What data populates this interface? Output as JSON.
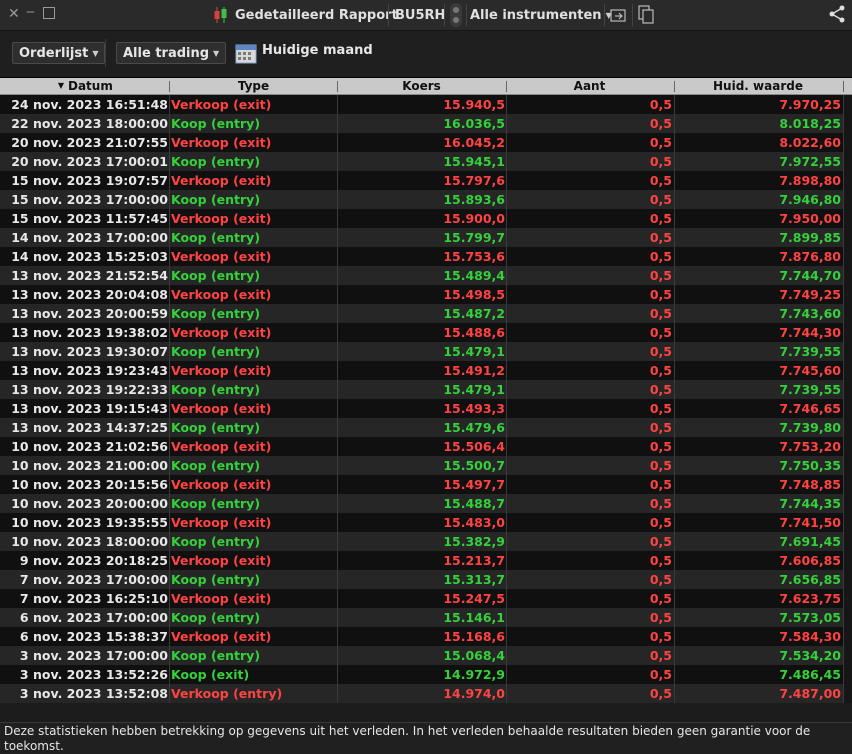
{
  "titlebar": {
    "report_title": "Gedetailleerd Rapport",
    "account_code": "BU5RH",
    "instruments_label": "Alle instrumenten"
  },
  "toolbar": {
    "orderlist_label": "Orderlijst",
    "trading_label": "Alle trading",
    "period_label": "Huidige maand"
  },
  "table": {
    "columns": [
      "Datum",
      "Type",
      "Koers",
      "Aant",
      "Huid. waarde"
    ],
    "sort_column": "Datum",
    "rows": [
      {
        "date": "24 nov. 2023 16:51:48",
        "type": "Verkoop (exit)",
        "side": "sell",
        "koers": "15.940,5",
        "aant": "0,5",
        "waarde": "7.970,25"
      },
      {
        "date": "22 nov. 2023 18:00:00",
        "type": "Koop (entry)",
        "side": "buy",
        "koers": "16.036,5",
        "aant": "0,5",
        "waarde": "8.018,25"
      },
      {
        "date": "20 nov. 2023 21:07:55",
        "type": "Verkoop (exit)",
        "side": "sell",
        "koers": "16.045,2",
        "aant": "0,5",
        "waarde": "8.022,60"
      },
      {
        "date": "20 nov. 2023 17:00:01",
        "type": "Koop (entry)",
        "side": "buy",
        "koers": "15.945,1",
        "aant": "0,5",
        "waarde": "7.972,55"
      },
      {
        "date": "15 nov. 2023 19:07:57",
        "type": "Verkoop (exit)",
        "side": "sell",
        "koers": "15.797,6",
        "aant": "0,5",
        "waarde": "7.898,80"
      },
      {
        "date": "15 nov. 2023 17:00:00",
        "type": "Koop (entry)",
        "side": "buy",
        "koers": "15.893,6",
        "aant": "0,5",
        "waarde": "7.946,80"
      },
      {
        "date": "15 nov. 2023 11:57:45",
        "type": "Verkoop (exit)",
        "side": "sell",
        "koers": "15.900,0",
        "aant": "0,5",
        "waarde": "7.950,00"
      },
      {
        "date": "14 nov. 2023 17:00:00",
        "type": "Koop (entry)",
        "side": "buy",
        "koers": "15.799,7",
        "aant": "0,5",
        "waarde": "7.899,85"
      },
      {
        "date": "14 nov. 2023 15:25:03",
        "type": "Verkoop (exit)",
        "side": "sell",
        "koers": "15.753,6",
        "aant": "0,5",
        "waarde": "7.876,80"
      },
      {
        "date": "13 nov. 2023 21:52:54",
        "type": "Koop (entry)",
        "side": "buy",
        "koers": "15.489,4",
        "aant": "0,5",
        "waarde": "7.744,70"
      },
      {
        "date": "13 nov. 2023 20:04:08",
        "type": "Verkoop (exit)",
        "side": "sell",
        "koers": "15.498,5",
        "aant": "0,5",
        "waarde": "7.749,25"
      },
      {
        "date": "13 nov. 2023 20:00:59",
        "type": "Koop (entry)",
        "side": "buy",
        "koers": "15.487,2",
        "aant": "0,5",
        "waarde": "7.743,60"
      },
      {
        "date": "13 nov. 2023 19:38:02",
        "type": "Verkoop (exit)",
        "side": "sell",
        "koers": "15.488,6",
        "aant": "0,5",
        "waarde": "7.744,30"
      },
      {
        "date": "13 nov. 2023 19:30:07",
        "type": "Koop (entry)",
        "side": "buy",
        "koers": "15.479,1",
        "aant": "0,5",
        "waarde": "7.739,55"
      },
      {
        "date": "13 nov. 2023 19:23:43",
        "type": "Verkoop (exit)",
        "side": "sell",
        "koers": "15.491,2",
        "aant": "0,5",
        "waarde": "7.745,60"
      },
      {
        "date": "13 nov. 2023 19:22:33",
        "type": "Koop (entry)",
        "side": "buy",
        "koers": "15.479,1",
        "aant": "0,5",
        "waarde": "7.739,55"
      },
      {
        "date": "13 nov. 2023 19:15:43",
        "type": "Verkoop (exit)",
        "side": "sell",
        "koers": "15.493,3",
        "aant": "0,5",
        "waarde": "7.746,65"
      },
      {
        "date": "13 nov. 2023 14:37:25",
        "type": "Koop (entry)",
        "side": "buy",
        "koers": "15.479,6",
        "aant": "0,5",
        "waarde": "7.739,80"
      },
      {
        "date": "10 nov. 2023 21:02:56",
        "type": "Verkoop (exit)",
        "side": "sell",
        "koers": "15.506,4",
        "aant": "0,5",
        "waarde": "7.753,20"
      },
      {
        "date": "10 nov. 2023 21:00:00",
        "type": "Koop (entry)",
        "side": "buy",
        "koers": "15.500,7",
        "aant": "0,5",
        "waarde": "7.750,35"
      },
      {
        "date": "10 nov. 2023 20:15:56",
        "type": "Verkoop (exit)",
        "side": "sell",
        "koers": "15.497,7",
        "aant": "0,5",
        "waarde": "7.748,85"
      },
      {
        "date": "10 nov. 2023 20:00:00",
        "type": "Koop (entry)",
        "side": "buy",
        "koers": "15.488,7",
        "aant": "0,5",
        "waarde": "7.744,35"
      },
      {
        "date": "10 nov. 2023 19:35:55",
        "type": "Verkoop (exit)",
        "side": "sell",
        "koers": "15.483,0",
        "aant": "0,5",
        "waarde": "7.741,50"
      },
      {
        "date": "10 nov. 2023 18:00:00",
        "type": "Koop (entry)",
        "side": "buy",
        "koers": "15.382,9",
        "aant": "0,5",
        "waarde": "7.691,45"
      },
      {
        "date": "9 nov. 2023 20:18:25",
        "type": "Verkoop (exit)",
        "side": "sell",
        "koers": "15.213,7",
        "aant": "0,5",
        "waarde": "7.606,85"
      },
      {
        "date": "7 nov. 2023 17:00:00",
        "type": "Koop (entry)",
        "side": "buy",
        "koers": "15.313,7",
        "aant": "0,5",
        "waarde": "7.656,85"
      },
      {
        "date": "7 nov. 2023 16:25:10",
        "type": "Verkoop (exit)",
        "side": "sell",
        "koers": "15.247,5",
        "aant": "0,5",
        "waarde": "7.623,75"
      },
      {
        "date": "6 nov. 2023 17:00:00",
        "type": "Koop (entry)",
        "side": "buy",
        "koers": "15.146,1",
        "aant": "0,5",
        "waarde": "7.573,05"
      },
      {
        "date": "6 nov. 2023 15:38:37",
        "type": "Verkoop (exit)",
        "side": "sell",
        "koers": "15.168,6",
        "aant": "0,5",
        "waarde": "7.584,30"
      },
      {
        "date": "3 nov. 2023 17:00:00",
        "type": "Koop (entry)",
        "side": "buy",
        "koers": "15.068,4",
        "aant": "0,5",
        "waarde": "7.534,20"
      },
      {
        "date": "3 nov. 2023 13:52:26",
        "type": "Koop (exit)",
        "side": "buy",
        "koers": "14.972,9",
        "aant": "0,5",
        "waarde": "7.486,45"
      },
      {
        "date": "3 nov. 2023 13:52:08",
        "type": "Verkoop (entry)",
        "side": "sell",
        "koers": "14.974,0",
        "aant": "0,5",
        "waarde": "7.487,00"
      }
    ]
  },
  "footer": {
    "disclaimer": "Deze statistieken hebben betrekking op gegevens uit het verleden. In het verleden behaalde resultaten bieden geen garantie voor de toekomst."
  },
  "colors": {
    "sell": "#ff4343",
    "buy": "#34d13a"
  },
  "icons": [
    "close-icon",
    "minimize-icon",
    "maximize-icon",
    "candlestick-icon",
    "link-handle-icon",
    "export-icon",
    "copy-icon",
    "share-icon",
    "calendar-icon",
    "sort-desc-icon"
  ]
}
